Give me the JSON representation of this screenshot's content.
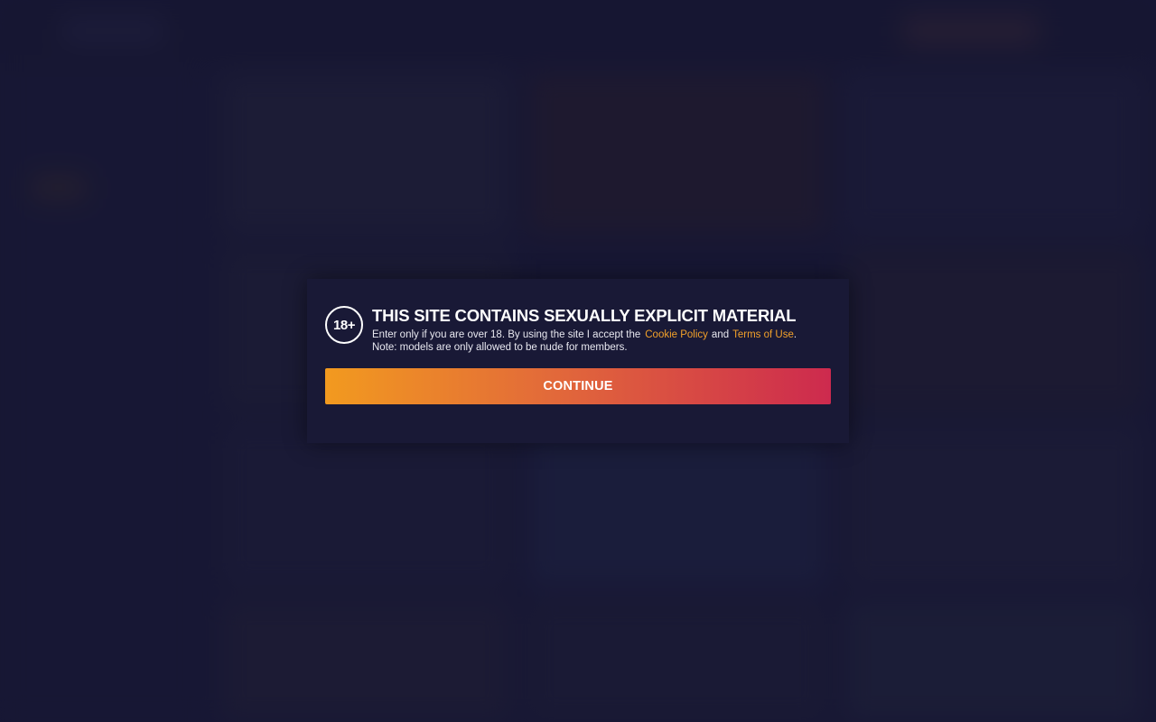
{
  "modal": {
    "badge": "18+",
    "title": "THIS SITE CONTAINS SEXUALLY EXPLICIT MATERIAL",
    "text_before": "Enter only if you are over 18. By using the site I accept the",
    "cookie_link": "Cookie Policy",
    "and_text": "and",
    "terms_link": "Terms of Use",
    "period": ".",
    "note": "Note: models are only allowed to be nude for members.",
    "continue_label": "CONTINUE"
  },
  "colors": {
    "background": "#1b1b3a",
    "modal_bg": "#191936",
    "link": "#f2a12a",
    "button_gradient_start": "#f29a1f",
    "button_gradient_end": "#cd2a4e"
  }
}
